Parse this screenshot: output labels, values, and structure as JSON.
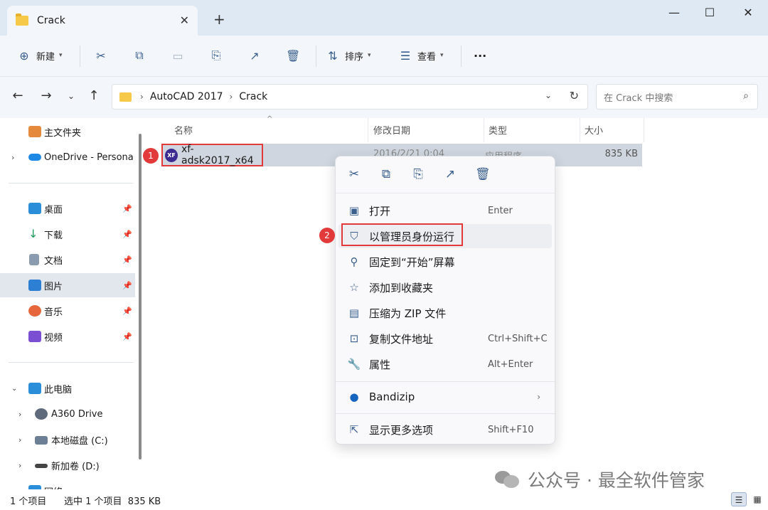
{
  "window": {
    "tab_title": "Crack",
    "tab_close": "✕",
    "new_tab": "+",
    "minimize": "—",
    "maximize": "☐",
    "close": "✕"
  },
  "toolbar": {
    "new_label": "新建",
    "sort_label": "排序",
    "view_label": "查看",
    "more_label": "···"
  },
  "address": {
    "crumbs": [
      "AutoCAD 2017",
      "Crack"
    ],
    "search_placeholder": "在 Crack 中搜索"
  },
  "sidebar": {
    "items": [
      {
        "label": "主文件夹",
        "icon": "home-icon",
        "color": "#e58a3c"
      },
      {
        "label": "OneDrive - Persona",
        "icon": "cloud-icon",
        "color": "#1e88e5"
      },
      {
        "label": "桌面",
        "icon": "desktop-icon",
        "color": "#2a8fd8"
      },
      {
        "label": "下载",
        "icon": "download-icon",
        "color": "#1e9a5c"
      },
      {
        "label": "文档",
        "icon": "document-icon",
        "color": "#6d7f95"
      },
      {
        "label": "图片",
        "icon": "picture-icon",
        "color": "#2d7fd3"
      },
      {
        "label": "音乐",
        "icon": "music-icon",
        "color": "#e6673b"
      },
      {
        "label": "视频",
        "icon": "video-icon",
        "color": "#7b4fd1"
      },
      {
        "label": "此电脑",
        "icon": "computer-icon",
        "color": "#2a8fd8"
      },
      {
        "label": "A360 Drive",
        "icon": "a360-drive-icon",
        "color": "#5f6b7a"
      },
      {
        "label": "本地磁盘 (C:)",
        "icon": "disk-c-icon",
        "color": "#6d7f95"
      },
      {
        "label": "新加卷 (D:)",
        "icon": "disk-d-icon",
        "color": "#444444"
      },
      {
        "label": "网络",
        "icon": "network-icon",
        "color": "#2a8fd8"
      }
    ]
  },
  "columns": {
    "name": "名称",
    "date": "修改日期",
    "type": "类型",
    "size": "大小"
  },
  "file": {
    "name": "xf-adsk2017_x64",
    "icon_text": "XF",
    "date": "2016/2/21 0:04",
    "type": "应用程序",
    "size": "835 KB"
  },
  "badges": {
    "one": "1",
    "two": "2"
  },
  "context_menu": {
    "items": [
      {
        "label": "打开",
        "shortcut": "Enter",
        "icon": "open-icon"
      },
      {
        "label": "以管理员身份运行",
        "shortcut": "",
        "icon": "shield-icon"
      },
      {
        "label": "固定到“开始”屏幕",
        "shortcut": "",
        "icon": "pin-icon"
      },
      {
        "label": "添加到收藏夹",
        "shortcut": "",
        "icon": "star-icon"
      },
      {
        "label": "压缩为 ZIP 文件",
        "shortcut": "",
        "icon": "zip-icon"
      },
      {
        "label": "复制文件地址",
        "shortcut": "Ctrl+Shift+C",
        "icon": "copy-path-icon"
      },
      {
        "label": "属性",
        "shortcut": "Alt+Enter",
        "icon": "wrench-icon"
      },
      {
        "label": "Bandizip",
        "shortcut": "",
        "icon": "bandizip-icon"
      },
      {
        "label": "显示更多选项",
        "shortcut": "Shift+F10",
        "icon": "more-options-icon"
      }
    ]
  },
  "status": {
    "count": "1 个项目",
    "selected": "选中 1 个项目  835 KB"
  },
  "watermark": {
    "text": "公众号 · 最全软件管家"
  },
  "colors": {
    "accent": "#3a5f8f",
    "highlight_red": "#e23a3a",
    "selection": "#cfd6df"
  }
}
